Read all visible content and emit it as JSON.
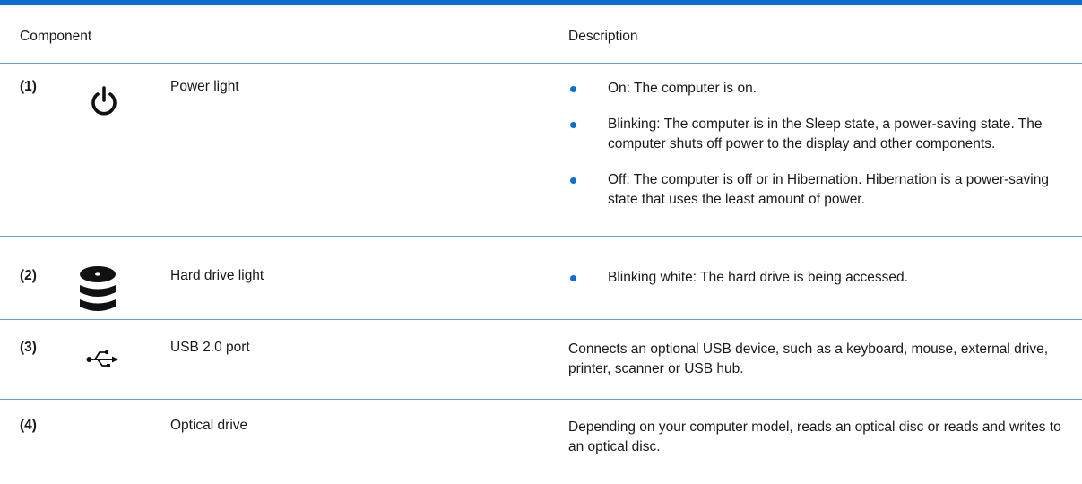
{
  "header": {
    "component": "Component",
    "description": "Description"
  },
  "colors": {
    "accent": "#0a6fd1",
    "rule": "#5ea1dc",
    "text": "#1a1a1a"
  },
  "rows": [
    {
      "number": "(1)",
      "icon": "power-icon",
      "name": "Power light",
      "bullets": [
        "On: The computer is on.",
        "Blinking: The computer is in the Sleep state, a power-saving state. The computer shuts off power to the display and other components.",
        "Off: The computer is off or in Hibernation. Hibernation is a power-saving state that uses the least amount of power."
      ]
    },
    {
      "number": "(2)",
      "icon": "hard-drive-icon",
      "name": "Hard drive light",
      "bullets": [
        "Blinking white: The hard drive is being accessed."
      ]
    },
    {
      "number": "(3)",
      "icon": "usb-icon",
      "name": "USB 2.0 port",
      "description": "Connects an optional USB device, such as a keyboard, mouse, external drive, printer, scanner or USB hub."
    },
    {
      "number": "(4)",
      "name": "Optical drive",
      "description": "Depending on your computer model, reads an optical disc or reads and writes to an optical disc."
    }
  ]
}
